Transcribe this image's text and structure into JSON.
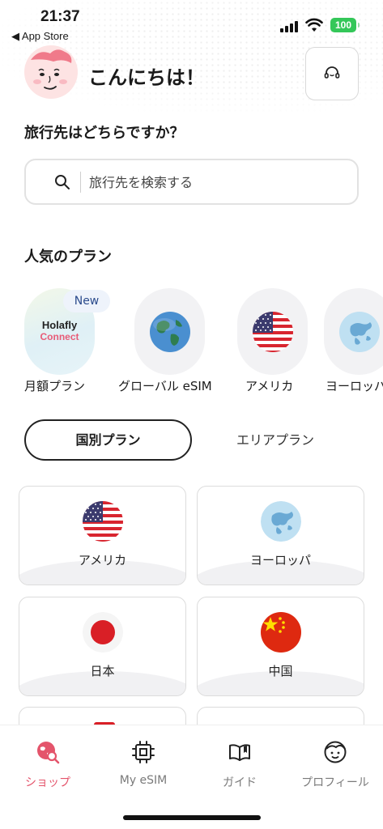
{
  "status_bar": {
    "time": "21:37",
    "back_app": "◀ App Store",
    "battery": "100"
  },
  "header": {
    "greeting": "こんにちは！"
  },
  "search": {
    "question": "旅行先はどちらですか？",
    "placeholder": "旅行先を検索する"
  },
  "popular": {
    "title": "人気のプラン",
    "items": [
      {
        "label": "月額プラン",
        "badge": "New",
        "brand_top": "Holafly",
        "brand_bottom": "Connect"
      },
      {
        "label": "グローバル eSIM"
      },
      {
        "label": "アメリカ"
      },
      {
        "label": "ヨーロッパ"
      }
    ]
  },
  "plan_tabs": {
    "country": "国別プラン",
    "area": "エリアプラン"
  },
  "countries": [
    {
      "label": "アメリカ",
      "flag": "us-flag"
    },
    {
      "label": "ヨーロッパ",
      "flag": "europe-globe"
    },
    {
      "label": "日本",
      "flag": "japan-flag"
    },
    {
      "label": "中国",
      "flag": "china-flag"
    }
  ],
  "tabbar": {
    "items": [
      {
        "label": "ショップ",
        "icon": "shop-search-icon"
      },
      {
        "label": "My eSIM",
        "icon": "chip-icon"
      },
      {
        "label": "ガイド",
        "icon": "book-icon"
      },
      {
        "label": "プロフィール",
        "icon": "face-icon"
      }
    ],
    "active_color": "#e4546b"
  }
}
